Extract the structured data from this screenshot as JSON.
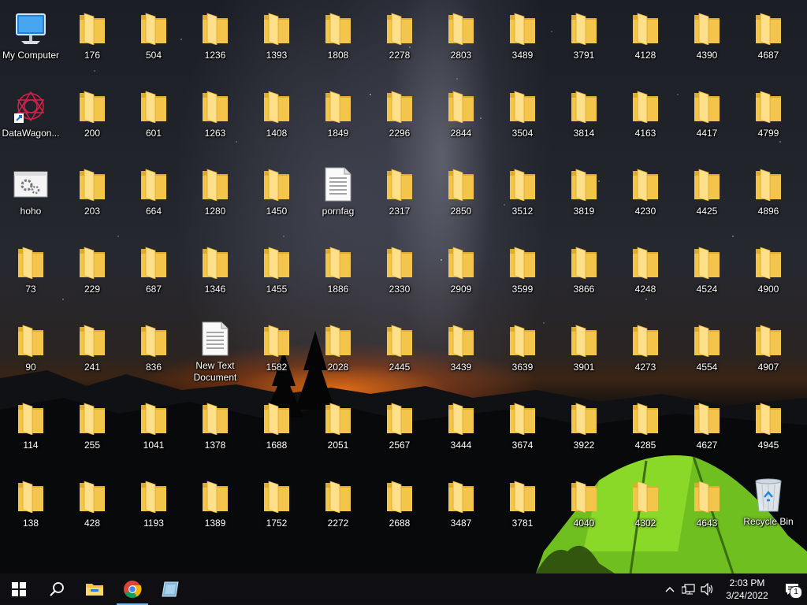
{
  "desktop": {
    "special_icons": {
      "my_computer": {
        "label": "My Computer",
        "icon": "computer-monitor-icon"
      },
      "datawagon": {
        "label": "DataWagon...",
        "icon": "red-spiral-app-shortcut-icon"
      },
      "hoho": {
        "label": "hoho",
        "icon": "application-window-gears-icon"
      },
      "pornfag": {
        "label": "pornfag",
        "icon": "text-file-icon"
      },
      "new_text_document": {
        "label": "New Text Document",
        "icon": "text-file-icon"
      },
      "recycle_bin": {
        "label": "Recycle Bin",
        "icon": "recycle-bin-icon"
      }
    },
    "folder_columns": [
      [
        "176",
        "200",
        "203",
        "229",
        "241",
        "255",
        "428"
      ],
      [
        "504",
        "601",
        "664",
        "687",
        "836",
        "1041",
        "1193"
      ],
      [
        "1236",
        "1263",
        "1280",
        "1346",
        "",
        "1378",
        "1389"
      ],
      [
        "1393",
        "1408",
        "1450",
        "1455",
        "1582",
        "1688",
        "1752"
      ],
      [
        "1808",
        "1849",
        "",
        "1886",
        "2028",
        "2051",
        "2272"
      ],
      [
        "2278",
        "2296",
        "2317",
        "2330",
        "2445",
        "2567",
        "2688"
      ],
      [
        "2803",
        "2844",
        "2850",
        "2909",
        "3439",
        "3444",
        "3487"
      ],
      [
        "3489",
        "3504",
        "3512",
        "3599",
        "3639",
        "3674",
        "3781"
      ],
      [
        "3791",
        "3814",
        "3819",
        "3866",
        "3901",
        "3922",
        "4040"
      ],
      [
        "4128",
        "4163",
        "4230",
        "4248",
        "4273",
        "4285",
        "4302"
      ],
      [
        "4390",
        "4417",
        "4425",
        "4524",
        "4554",
        "4627",
        "4643"
      ],
      [
        "4687",
        "4799",
        "4896",
        "4900",
        "4907",
        "4945",
        ""
      ]
    ],
    "first_column_folders": [
      "73",
      "90",
      "114",
      "138"
    ]
  },
  "taskbar": {
    "items": [
      {
        "name": "start-button",
        "icon": "windows-logo-icon"
      },
      {
        "name": "search-button",
        "icon": "search-icon"
      },
      {
        "name": "file-explorer-button",
        "icon": "folder-icon"
      },
      {
        "name": "chrome-button",
        "icon": "chrome-icon",
        "active": true
      },
      {
        "name": "app-button",
        "icon": "blue-book-icon"
      }
    ],
    "tray": {
      "time": "2:03 PM",
      "date": "3/24/2022",
      "notification_count": "1"
    }
  },
  "colors": {
    "folder_yellow": "#f3c54a",
    "folder_light": "#ffe08a",
    "taskbar_bg": "#101014",
    "accent": "#76b9ed"
  }
}
